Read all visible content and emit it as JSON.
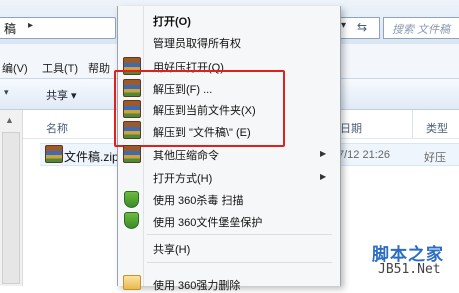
{
  "address_bar": {
    "path_text": "稿",
    "search_placeholder": "搜索 文件稿"
  },
  "menu_bar": [
    "编(V)",
    "工具(T)",
    "帮助"
  ],
  "command_bar": {
    "share_label": "共享 ▾"
  },
  "columns": {
    "name": "名称",
    "date": "日期",
    "type": "类型"
  },
  "file": {
    "name": "文件稿.zip",
    "date": "7/12 21:26",
    "type": "好压"
  },
  "context_menu": {
    "items": [
      {
        "label": "打开(O)",
        "bold": true
      },
      {
        "label": "管理员取得所有权"
      },
      {
        "label": "用好压打开(Q)",
        "icon": "haozip-icon"
      },
      {
        "label": "解压到(F) ...",
        "icon": "winrar-icon"
      },
      {
        "label": "解压到当前文件夹(X)",
        "icon": "winrar-icon"
      },
      {
        "label": "解压到 \"文件稿\\\" (E)",
        "icon": "winrar-icon"
      },
      {
        "label": "其他压缩命令",
        "icon": "winrar-icon",
        "submenu": true
      },
      {
        "label": "打开方式(H)",
        "submenu": true
      },
      {
        "label": "使用 360杀毒 扫描",
        "icon": "360-shield-icon"
      },
      {
        "label": "使用 360文件堡垒保护",
        "icon": "360-shield-icon"
      },
      {
        "label": "共享(H)"
      },
      {
        "label": "使用 360强力删除",
        "icon": "360-icon"
      }
    ]
  },
  "watermark": {
    "cn": "脚本之家",
    "url": "JB51.Net"
  }
}
